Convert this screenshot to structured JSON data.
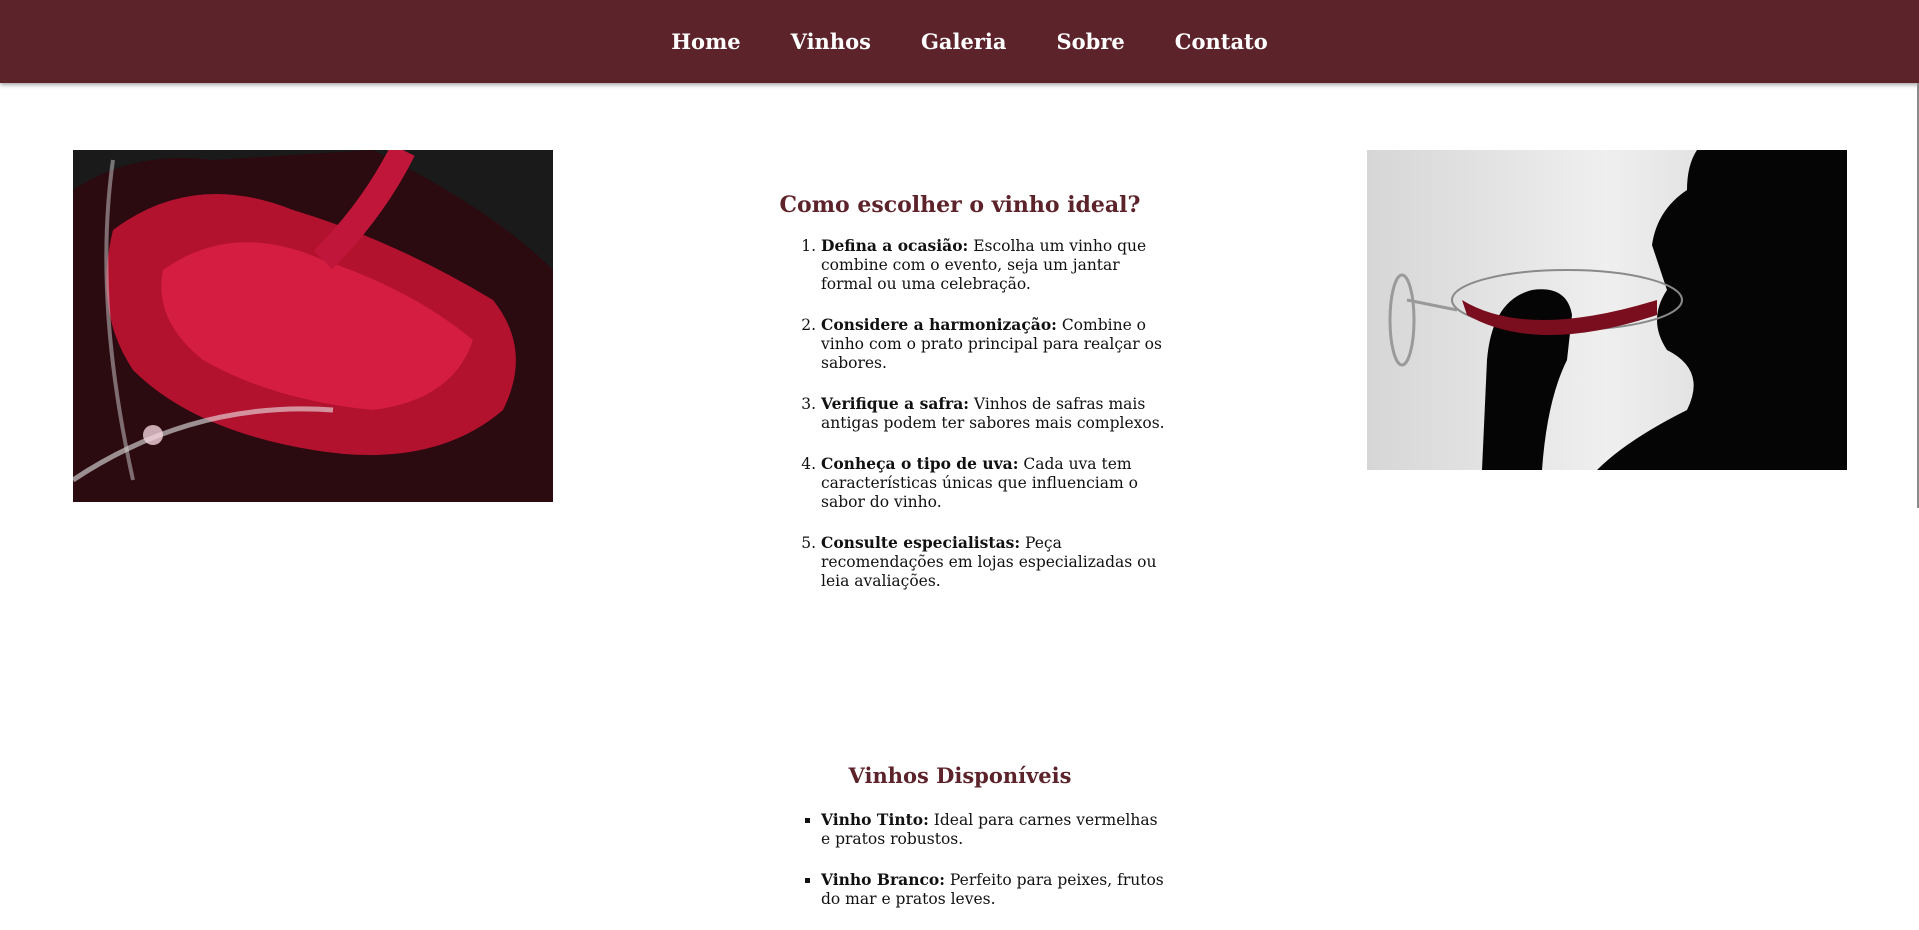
{
  "nav": {
    "items": [
      {
        "label": "Home"
      },
      {
        "label": "Vinhos"
      },
      {
        "label": "Galeria"
      },
      {
        "label": "Sobre"
      },
      {
        "label": "Contato"
      }
    ]
  },
  "colors": {
    "brand": "#5d232a",
    "background": "#ffffff"
  },
  "images": {
    "left": "red-wine-splash-photo",
    "right": "woman-drinking-wine-silhouette-photo"
  },
  "guide": {
    "title": "Como escolher o vinho ideal?",
    "steps": [
      {
        "bold": "Defina a ocasião:",
        "text": " Escolha um vinho que combine com o evento, seja um jantar formal ou uma celebração."
      },
      {
        "bold": "Considere a harmonização:",
        "text": " Combine o vinho com o prato principal para realçar os sabores."
      },
      {
        "bold": "Verifique a safra:",
        "text": " Vinhos de safras mais antigas podem ter sabores mais complexos."
      },
      {
        "bold": "Conheça o tipo de uva:",
        "text": " Cada uva tem características únicas que influenciam o sabor do vinho."
      },
      {
        "bold": "Consulte especialistas:",
        "text": " Peça recomendações em lojas especializadas ou leia avaliações."
      }
    ]
  },
  "wines": {
    "title": "Vinhos Disponíveis",
    "items": [
      {
        "bold": "Vinho Tinto:",
        "text": " Ideal para carnes vermelhas e pratos robustos."
      },
      {
        "bold": "Vinho Branco:",
        "text": " Perfeito para peixes, frutos do mar e pratos leves."
      }
    ]
  }
}
